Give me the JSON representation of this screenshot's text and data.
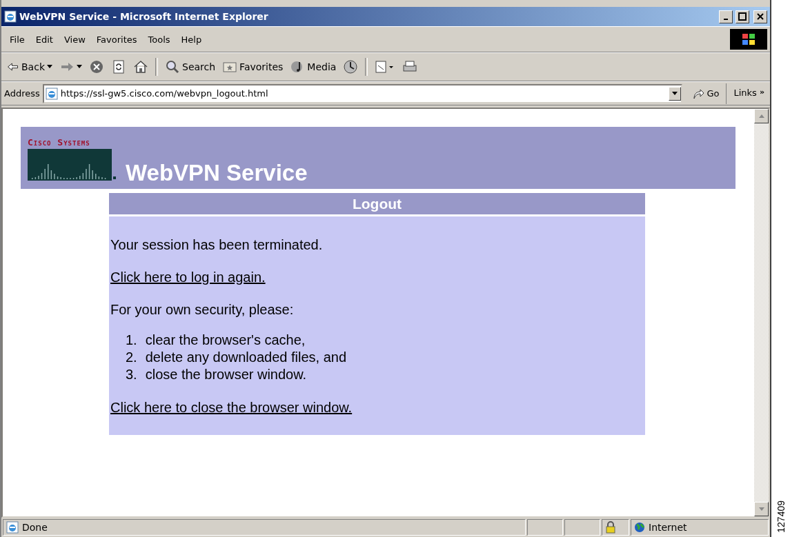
{
  "window": {
    "title": "WebVPN Service - Microsoft Internet Explorer"
  },
  "menu": [
    "File",
    "Edit",
    "View",
    "Favorites",
    "Tools",
    "Help"
  ],
  "toolbar": [
    {
      "kind": "back",
      "label": "Back"
    },
    {
      "kind": "forward"
    },
    {
      "kind": "stop"
    },
    {
      "kind": "refresh"
    },
    {
      "kind": "home"
    },
    {
      "kind": "search",
      "label": "Search"
    },
    {
      "kind": "favorites",
      "label": "Favorites"
    },
    {
      "kind": "media",
      "label": "Media"
    },
    {
      "kind": "history"
    },
    {
      "kind": "mail"
    },
    {
      "kind": "print"
    }
  ],
  "address": {
    "label": "Address",
    "value": "https://ssl-gw5.cisco.com/webvpn_logout.html",
    "go": "Go",
    "links": "Links",
    "links_more": "»"
  },
  "page": {
    "brand": "Cisco Systems",
    "title": "WebVPN Service",
    "panel": {
      "heading": "Logout",
      "message": "Your session has been terminated.",
      "login_link": "Click here to log in again.",
      "security_text": "For your own security, please:",
      "steps": [
        {
          "number": "1.",
          "text": "clear the browser's cache,"
        },
        {
          "number": "2.",
          "text": "delete any downloaded files, and"
        },
        {
          "number": "3.",
          "text": "close the browser window."
        }
      ],
      "close_link": "Click here to close the browser window."
    }
  },
  "status_bar": {
    "text": "Done",
    "zone": "Internet"
  },
  "figure_number": "127409"
}
